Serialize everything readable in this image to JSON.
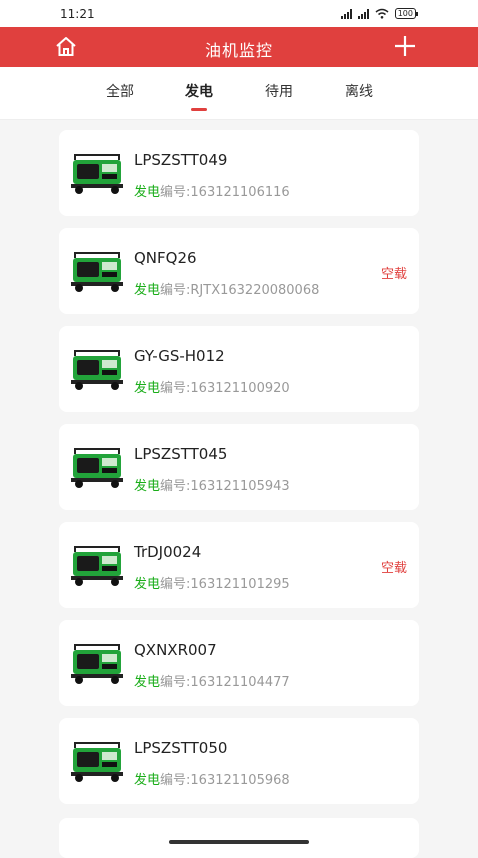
{
  "status_bar": {
    "time": "11:21",
    "battery": "100"
  },
  "header": {
    "title": "油机监控",
    "accent": "#e0403e"
  },
  "tabs": [
    {
      "label": "全部"
    },
    {
      "label": "发电"
    },
    {
      "label": "待用"
    },
    {
      "label": "离线"
    }
  ],
  "active_tab": "发电",
  "colors": {
    "status_green": "#1aad19",
    "badge_red": "#e0403e"
  },
  "devices": [
    {
      "name": "LPSZSTT049",
      "status": "发电",
      "code": "编号:163121106116",
      "badge": ""
    },
    {
      "name": "QNFQ26",
      "status": "发电",
      "code": "编号:RJTX163220080068",
      "badge": "空载"
    },
    {
      "name": "GY-GS-H012",
      "status": "发电",
      "code": "编号:163121100920",
      "badge": ""
    },
    {
      "name": "LPSZSTT045",
      "status": "发电",
      "code": "编号:163121105943",
      "badge": ""
    },
    {
      "name": "TrDJ0024",
      "status": "发电",
      "code": "编号:163121101295",
      "badge": "空载"
    },
    {
      "name": "QXNXR007",
      "status": "发电",
      "code": "编号:163121104477",
      "badge": ""
    },
    {
      "name": "LPSZSTT050",
      "status": "发电",
      "code": "编号:163121105968",
      "badge": ""
    }
  ]
}
